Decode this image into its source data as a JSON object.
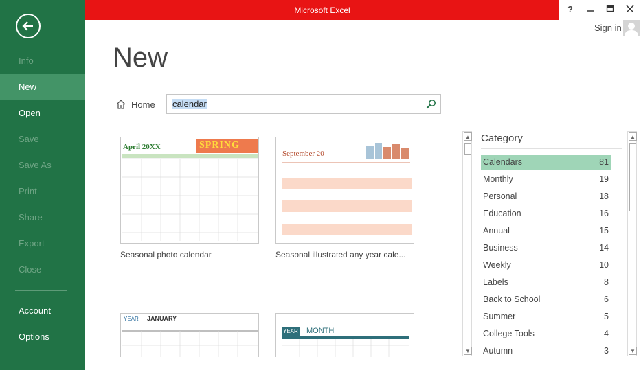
{
  "app": {
    "title": "Microsoft Excel",
    "help": "?",
    "signin": "Sign in"
  },
  "sidebar": {
    "items": [
      {
        "label": "Info",
        "state": "disabled"
      },
      {
        "label": "New",
        "state": "selected"
      },
      {
        "label": "Open",
        "state": "normal"
      },
      {
        "label": "Save",
        "state": "disabled"
      },
      {
        "label": "Save As",
        "state": "disabled"
      },
      {
        "label": "Print",
        "state": "disabled"
      },
      {
        "label": "Share",
        "state": "disabled"
      },
      {
        "label": "Export",
        "state": "disabled"
      },
      {
        "label": "Close",
        "state": "disabled"
      },
      {
        "label": "Account",
        "state": "normal"
      },
      {
        "label": "Options",
        "state": "normal"
      }
    ]
  },
  "main": {
    "title": "New",
    "home_label": "Home",
    "search": {
      "value": "calendar"
    },
    "templates": [
      {
        "label": "Seasonal photo calendar",
        "thumb_title": "April 20XX",
        "thumb_art": "SPRING"
      },
      {
        "label": "Seasonal illustrated any year cale...",
        "thumb_title": "September 20__"
      },
      {
        "label": "",
        "thumb_title": "JANUARY",
        "thumb_sub": "YEAR"
      },
      {
        "label": "",
        "thumb_title": "MONTH",
        "thumb_sub": "YEAR"
      }
    ]
  },
  "category": {
    "title": "Category",
    "items": [
      {
        "name": "Calendars",
        "count": "81"
      },
      {
        "name": "Monthly",
        "count": "19"
      },
      {
        "name": "Personal",
        "count": "18"
      },
      {
        "name": "Education",
        "count": "16"
      },
      {
        "name": "Annual",
        "count": "15"
      },
      {
        "name": "Business",
        "count": "14"
      },
      {
        "name": "Weekly",
        "count": "10"
      },
      {
        "name": "Labels",
        "count": "8"
      },
      {
        "name": "Back to School",
        "count": "6"
      },
      {
        "name": "Summer",
        "count": "5"
      },
      {
        "name": "College Tools",
        "count": "4"
      },
      {
        "name": "Autumn",
        "count": "3"
      }
    ]
  },
  "colors": {
    "accent": "#217346",
    "titlebar": "#e81414",
    "selected": "#9fd5b7"
  }
}
